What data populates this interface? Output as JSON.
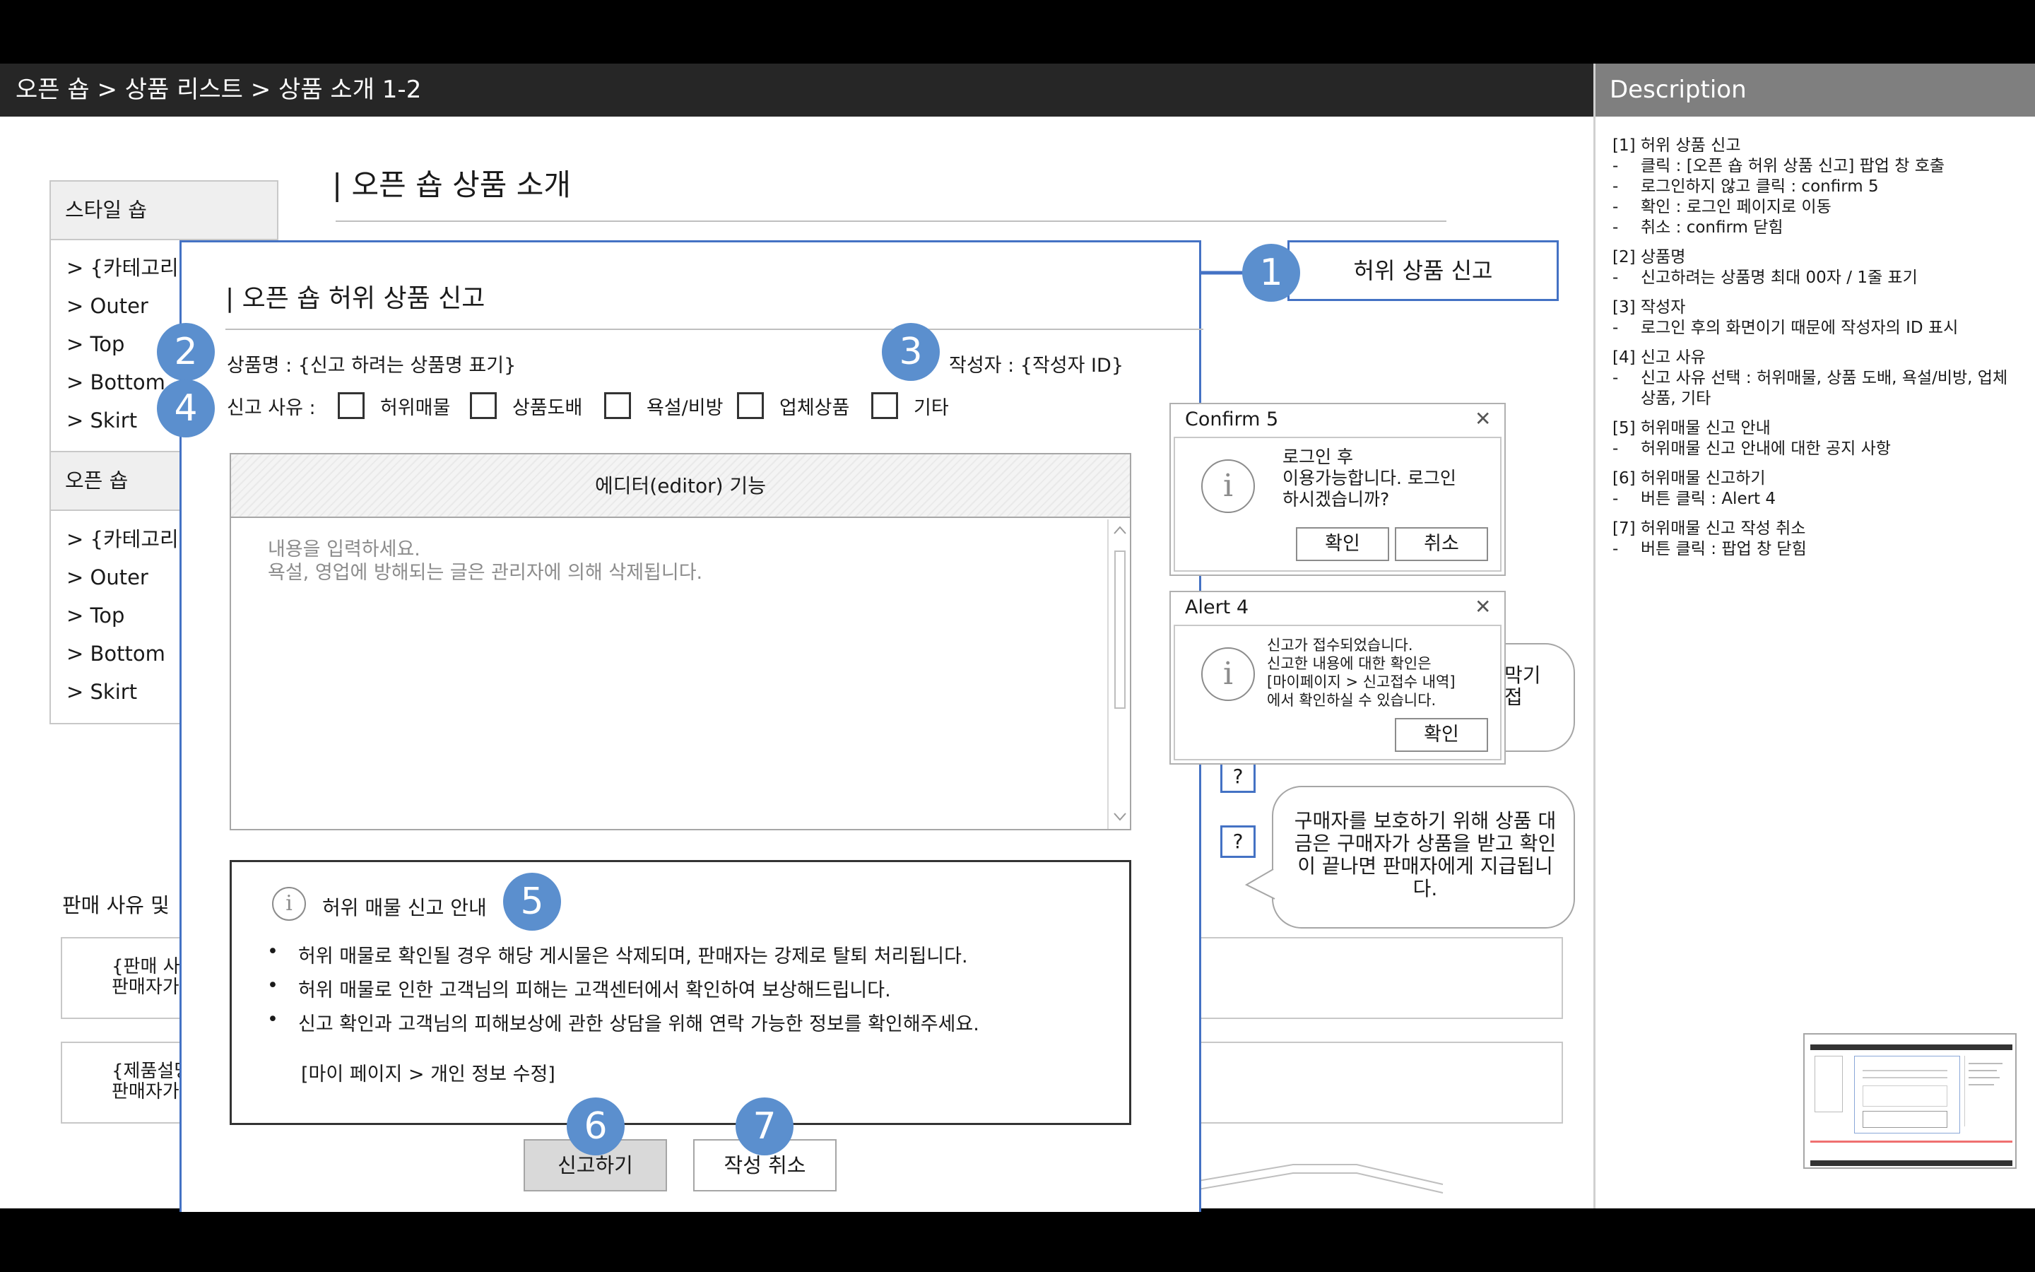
{
  "header": {
    "breadcrumb": "오픈 숍 > 상품 리스트 > 상품 소개 1-2"
  },
  "description": {
    "title": "Description",
    "sections": [
      {
        "title": "[1] 허위 상품 신고",
        "items": [
          "클릭 : [오픈 숍 허위 상품 신고] 팝업 창 호출",
          "로그인하지 않고 클릭 : confirm 5",
          "확인 : 로그인 페이지로 이동",
          "취소 : confirm 닫힘"
        ]
      },
      {
        "title": "[2] 상품명",
        "items": [
          "신고하려는 상품명 최대 00자 / 1줄 표기"
        ]
      },
      {
        "title": "[3] 작성자",
        "items": [
          "로그인 후의 화면이기 때문에 작성자의 ID 표시"
        ]
      },
      {
        "title": "[4] 신고 사유",
        "items": [
          "신고 사유 선택 : 허위매물, 상품 도배, 욕설/비방, 업체상품, 기타"
        ]
      },
      {
        "title": "[5] 허위매물 신고 안내",
        "items": [
          "허위매물 신고 안내에 대한 공지 사항"
        ]
      },
      {
        "title": "[6] 허위매물 신고하기",
        "items": [
          "버튼 클릭 : Alert 4"
        ]
      },
      {
        "title": "[7] 허위매물 신고 작성 취소",
        "items": [
          "버튼 클릭 : 팝업 창 닫힘"
        ]
      }
    ]
  },
  "sidebar": {
    "sections": [
      {
        "title": "스타일 숍",
        "items": [
          "> {카테고리}",
          "> Outer",
          "> Top",
          "> Bottom",
          "> Skirt"
        ]
      },
      {
        "title": "오픈 숍",
        "items": [
          "> {카테고리}",
          "> Outer",
          "> Top",
          "> Bottom",
          "> Skirt"
        ]
      }
    ]
  },
  "page": {
    "title": "| 오픈 숍 상품 소개",
    "reason_label": "판매 사유 및",
    "box1": [
      "{판매 사",
      "판매자가"
    ],
    "box2": [
      "{제품설명",
      "판매자가"
    ],
    "bubble1": [
      "막기",
      "접"
    ],
    "bubble2": "구매자를 보호하기 위해 상품 대금은 구매자가 상품을 받고 확인이 끝나면 판매자에게 지급됩니다.",
    "question": "?"
  },
  "report_button": {
    "label": "허위 상품 신고"
  },
  "modal": {
    "title": "| 오픈 숍 허위 상품 신고",
    "product_label": "상품명 : {신고 하려는 상품명 표기}",
    "writer_label": "작성자 : {작성자 ID}",
    "reason_label": "신고 사유 :",
    "reasons": [
      "허위매물",
      "상품도배",
      "욕설/비방",
      "업체상품",
      "기타"
    ],
    "editor": {
      "header": "에디터(editor) 기능",
      "placeholder_line1": "내용을 입력하세요.",
      "placeholder_line2": "욕설, 영업에 방해되는 글은 관리자에 의해 삭제됩니다."
    },
    "notice": {
      "title": "허위 매물 신고 안내",
      "items": [
        "허위 매물로 확인될 경우 해당 게시물은 삭제되며, 판매자는 강제로 탈퇴 처리됩니다.",
        "허위 매물로 인한 고객님의 피해는 고객센터에서 확인하여 보상해드립니다.",
        "신고 확인과 고객님의 피해보상에 관한 상담을 위해 연락 가능한 정보를 확인해주세요."
      ],
      "link": "[마이 페이지 > 개인 정보 수정]"
    },
    "submit_label": "신고하기",
    "cancel_label": "작성 취소"
  },
  "callouts": [
    "1",
    "2",
    "3",
    "4",
    "5",
    "6",
    "7"
  ],
  "confirm5": {
    "title": "Confirm 5",
    "close": "✕",
    "message": [
      "로그인 후",
      "이용가능합니다. 로그인",
      "하시겠습니까?"
    ],
    "ok": "확인",
    "cancel": "취소"
  },
  "alert4": {
    "title": "Alert 4",
    "close": "✕",
    "message": [
      "신고가 접수되었습니다.",
      "신고한 내용에 대한 확인은",
      "[마이페이지 > 신고접수 내역]",
      "에서 확인하실 수 있습니다."
    ],
    "ok": "확인"
  },
  "info_glyph": "i",
  "colors": {
    "accent": "#4472c4",
    "callout": "#5b8fce",
    "header_bg": "#262626",
    "desc_header_bg": "#7f7f7f"
  }
}
